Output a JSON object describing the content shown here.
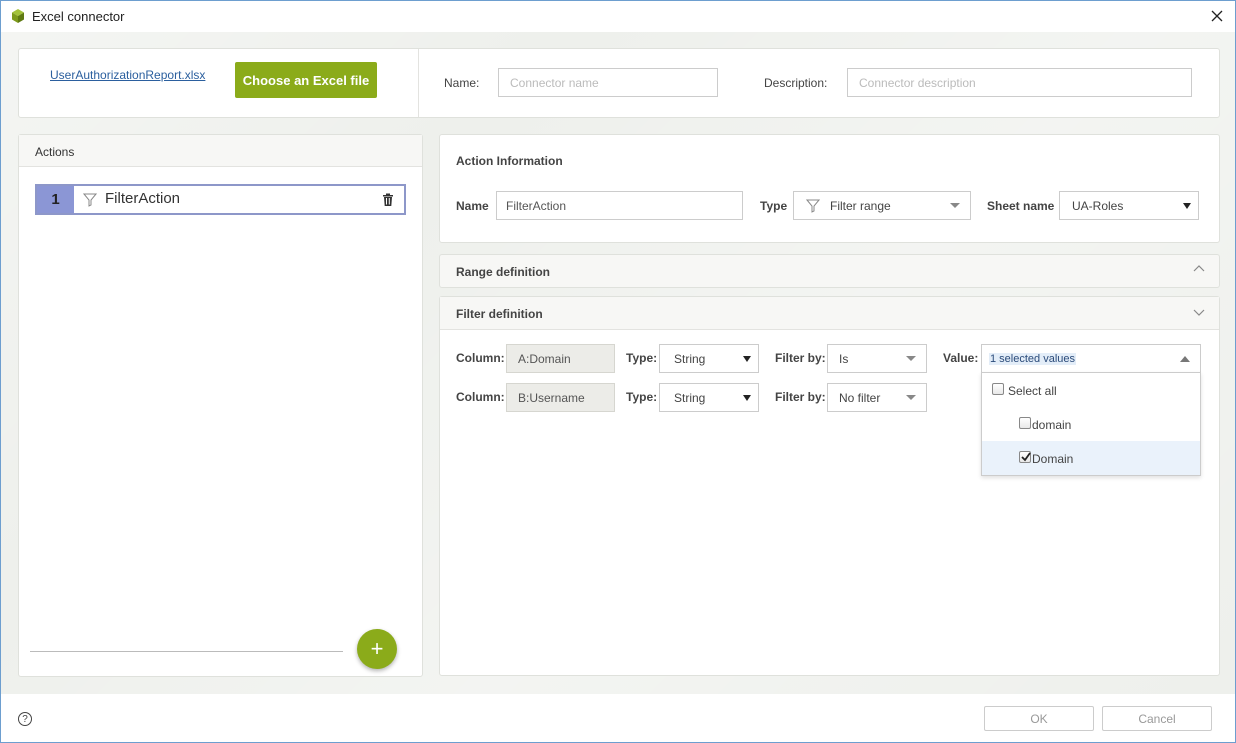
{
  "window": {
    "title": "Excel connector"
  },
  "top": {
    "file_link": "UserAuthorizationReport.xlsx",
    "choose_button": "Choose an Excel file",
    "name_label": "Name:",
    "name_placeholder": "Connector name",
    "description_label": "Description:",
    "description_placeholder": "Connector description"
  },
  "actions": {
    "header": "Actions",
    "items": [
      {
        "number": "1",
        "name": "FilterAction"
      }
    ],
    "add_label": "+"
  },
  "action_info": {
    "header": "Action Information",
    "name_label": "Name",
    "name_value": "FilterAction",
    "type_label": "Type",
    "type_value": "Filter range",
    "sheet_label": "Sheet name",
    "sheet_value": "UA-Roles"
  },
  "range_definition": {
    "header": "Range definition"
  },
  "filter_definition": {
    "header": "Filter definition",
    "rows": [
      {
        "column_label": "Column:",
        "column_value": "A:Domain",
        "type_label": "Type:",
        "type_value": "String",
        "filter_label": "Filter by:",
        "filter_value": "Is"
      },
      {
        "column_label": "Column:",
        "column_value": "B:Username",
        "type_label": "Type:",
        "type_value": "String",
        "filter_label": "Filter by:",
        "filter_value": "No filter"
      }
    ],
    "value_label": "Value:",
    "value_summary": "1 selected values",
    "options": [
      {
        "label": "Select all",
        "checked": false
      },
      {
        "label": "domain",
        "checked": false
      },
      {
        "label": "Domain",
        "checked": true
      }
    ]
  },
  "footer": {
    "help": "?",
    "ok": "OK",
    "cancel": "Cancel"
  },
  "colors": {
    "accent": "#8bab1a",
    "action_number_bg": "#8b96d5",
    "highlight": "#eaf2fb"
  }
}
